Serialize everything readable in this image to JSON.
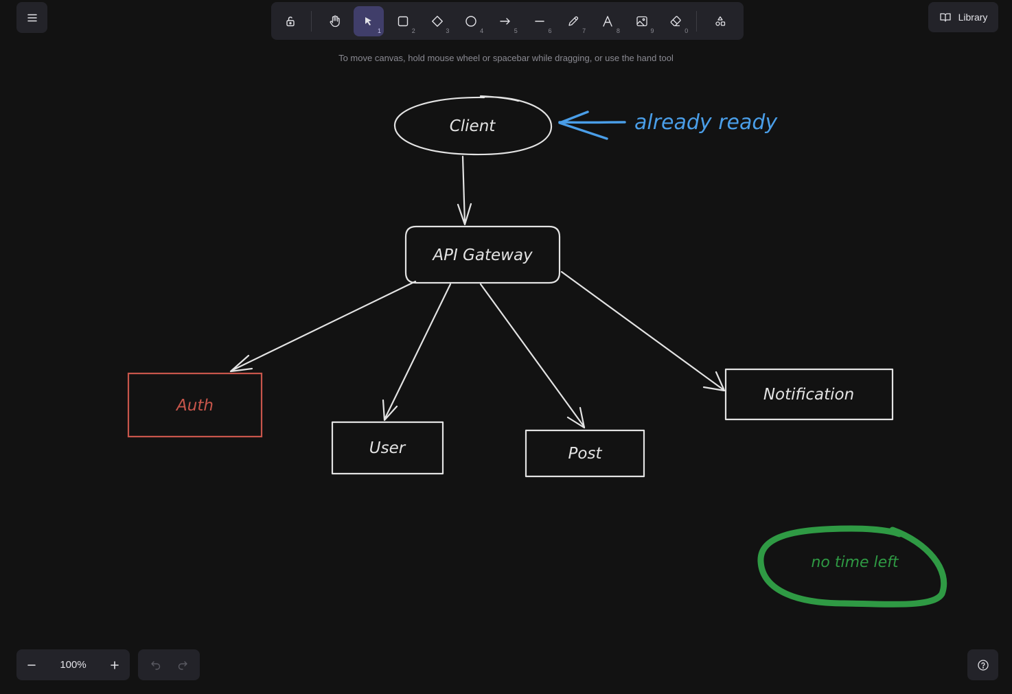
{
  "toolbar": {
    "tools": [
      {
        "name": "lock",
        "key": ""
      },
      {
        "name": "hand",
        "key": ""
      },
      {
        "name": "selection",
        "key": "1"
      },
      {
        "name": "rectangle",
        "key": "2"
      },
      {
        "name": "diamond",
        "key": "3"
      },
      {
        "name": "ellipse",
        "key": "4"
      },
      {
        "name": "arrow",
        "key": "5"
      },
      {
        "name": "line",
        "key": "6"
      },
      {
        "name": "draw",
        "key": "7"
      },
      {
        "name": "text",
        "key": "8"
      },
      {
        "name": "image",
        "key": "9"
      },
      {
        "name": "eraser",
        "key": "0"
      },
      {
        "name": "extra-tools",
        "key": ""
      }
    ],
    "active_tool": "selection"
  },
  "library": {
    "label": "Library"
  },
  "hint": "To move canvas, hold mouse wheel or spacebar while dragging, or use the hand tool",
  "diagram": {
    "nodes": {
      "client": "Client",
      "gateway": "API Gateway",
      "auth": "Auth",
      "user": "User",
      "post": "Post",
      "notification": "Notification"
    },
    "annotations": {
      "ready": "already ready",
      "no_time": "no time left"
    }
  },
  "zoom": {
    "value": "100%"
  },
  "colors": {
    "background": "#121212",
    "stroke": "#e3e3e3",
    "auth": "#c8564b",
    "blue": "#4a9ee8",
    "green": "#2f9a44",
    "active_tool": "#403e6a"
  }
}
